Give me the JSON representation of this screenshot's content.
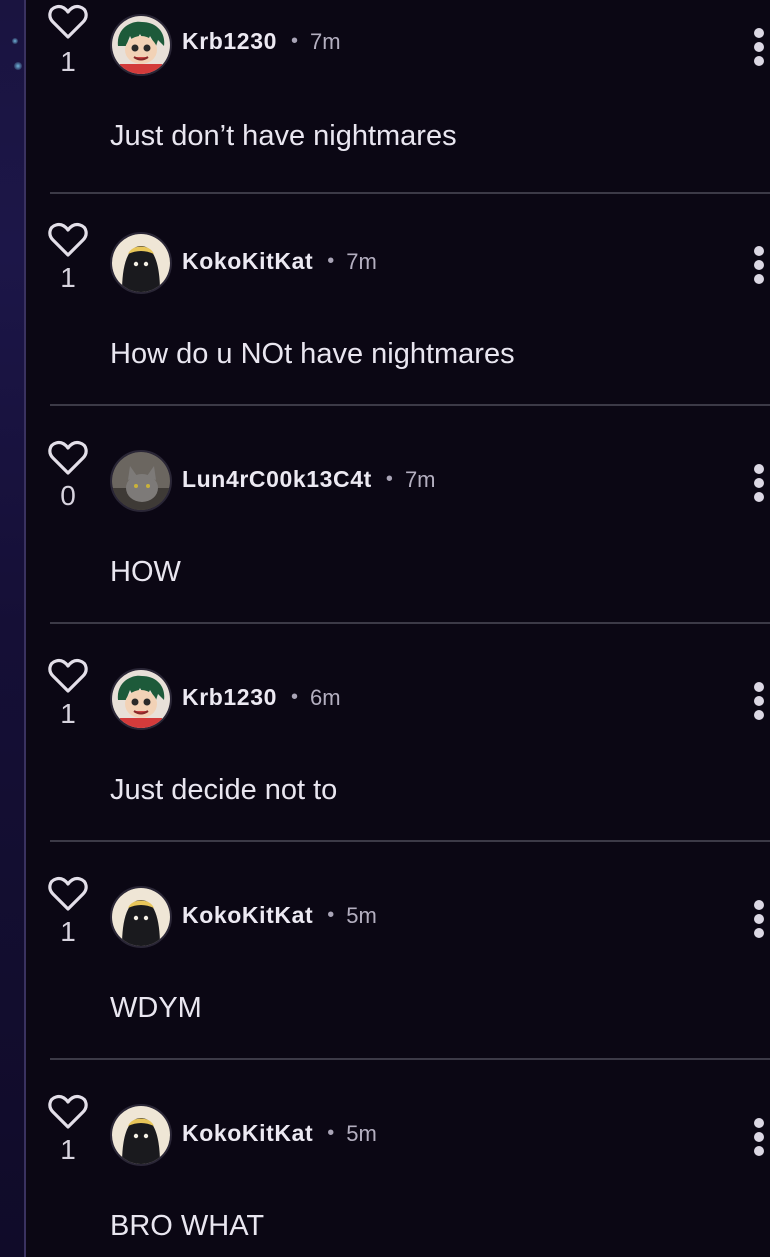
{
  "colors": {
    "background": "#0b0714",
    "divider": "#3c3a47",
    "text": "#e9e6f0",
    "muted": "#b4afc0"
  },
  "comments": [
    {
      "likes": "1",
      "username": "Krb1230",
      "separator": "•",
      "time": "7m",
      "text": "Just don’t have nightmares",
      "avatar": "green-hair-anime-avatar"
    },
    {
      "likes": "1",
      "username": "KokoKitKat",
      "separator": "•",
      "time": "7m",
      "text": "How do u NOt have nightmares",
      "avatar": "hooded-figure-avatar"
    },
    {
      "likes": "0",
      "username": "Lun4rC00k13C4t",
      "separator": "•",
      "time": "7m",
      "text": "HOW",
      "avatar": "gray-cat-avatar"
    },
    {
      "likes": "1",
      "username": "Krb1230",
      "separator": "•",
      "time": "6m",
      "text": "Just decide not to",
      "avatar": "green-hair-anime-avatar"
    },
    {
      "likes": "1",
      "username": "KokoKitKat",
      "separator": "•",
      "time": "5m",
      "text": "WDYM",
      "avatar": "hooded-figure-avatar"
    },
    {
      "likes": "1",
      "username": "KokoKitKat",
      "separator": "•",
      "time": "5m",
      "text": "BRO WHAT",
      "avatar": "hooded-figure-avatar"
    }
  ]
}
